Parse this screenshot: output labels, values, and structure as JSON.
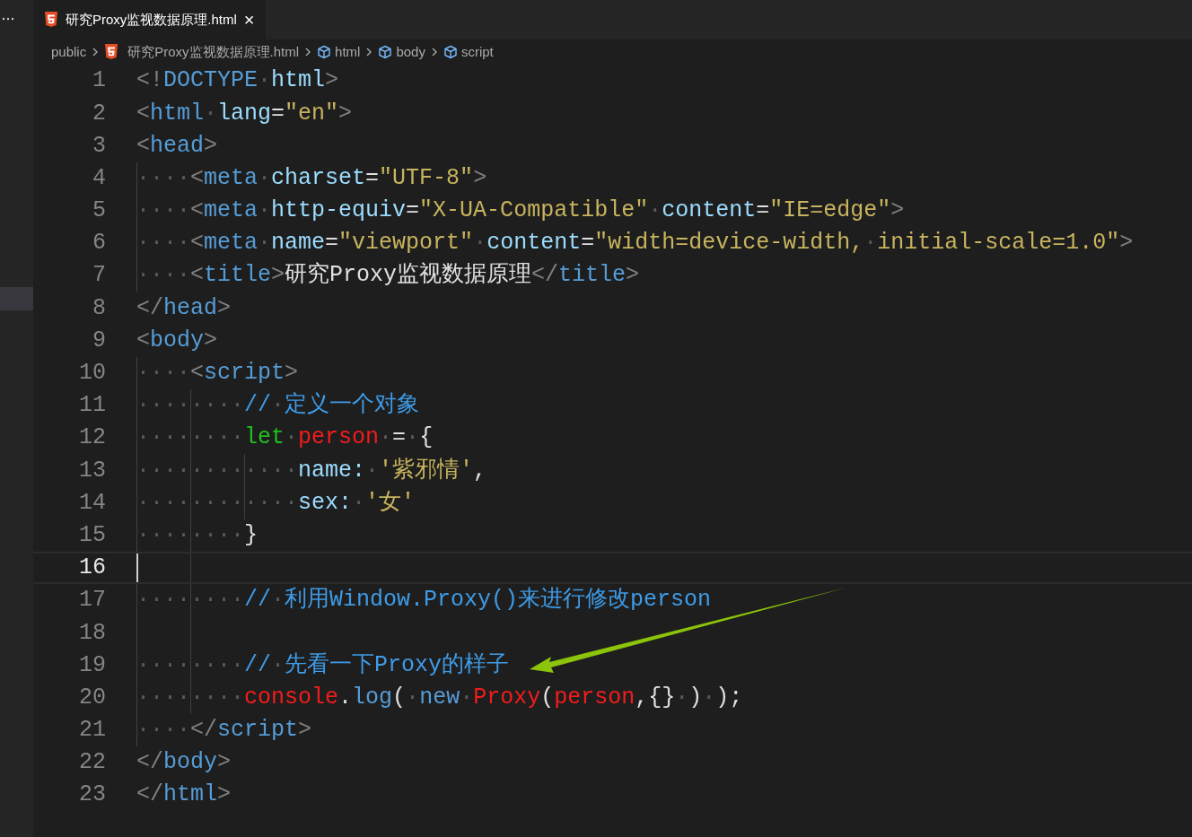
{
  "tab": {
    "title": "研究Proxy监视数据原理.html",
    "close": "×",
    "selected": true
  },
  "breadcrumbs": [
    {
      "kind": "folder",
      "label": "public"
    },
    {
      "kind": "file",
      "label": "研究Proxy监视数据原理.html"
    },
    {
      "kind": "symbol",
      "label": "html"
    },
    {
      "kind": "symbol",
      "label": "body"
    },
    {
      "kind": "symbol",
      "label": "script"
    }
  ],
  "lines": [
    {
      "number": "1",
      "current": false,
      "tokens": [
        {
          "kind": "p",
          "text": "<!"
        },
        {
          "kind": "t",
          "text": "DOCTYPE"
        },
        {
          "kind": "w",
          "text": "·"
        },
        {
          "kind": "a",
          "text": "html"
        },
        {
          "kind": "p",
          "text": ">"
        }
      ]
    },
    {
      "number": "2",
      "current": false,
      "tokens": [
        {
          "kind": "p",
          "text": "<"
        },
        {
          "kind": "t",
          "text": "html"
        },
        {
          "kind": "w",
          "text": "·"
        },
        {
          "kind": "a",
          "text": "lang"
        },
        {
          "kind": "x",
          "text": "="
        },
        {
          "kind": "s",
          "text": "\"en\""
        },
        {
          "kind": "p",
          "text": ">"
        }
      ]
    },
    {
      "number": "3",
      "current": false,
      "tokens": [
        {
          "kind": "p",
          "text": "<"
        },
        {
          "kind": "t",
          "text": "head"
        },
        {
          "kind": "p",
          "text": ">"
        }
      ]
    },
    {
      "number": "4",
      "current": false,
      "tokens": [
        {
          "kind": "w",
          "text": "····"
        },
        {
          "kind": "p",
          "text": "<"
        },
        {
          "kind": "t",
          "text": "meta"
        },
        {
          "kind": "w",
          "text": "·"
        },
        {
          "kind": "a",
          "text": "charset"
        },
        {
          "kind": "x",
          "text": "="
        },
        {
          "kind": "s",
          "text": "\"UTF-8\""
        },
        {
          "kind": "p",
          "text": ">"
        }
      ]
    },
    {
      "number": "5",
      "current": false,
      "tokens": [
        {
          "kind": "w",
          "text": "····"
        },
        {
          "kind": "p",
          "text": "<"
        },
        {
          "kind": "t",
          "text": "meta"
        },
        {
          "kind": "w",
          "text": "·"
        },
        {
          "kind": "a",
          "text": "http-equiv"
        },
        {
          "kind": "x",
          "text": "="
        },
        {
          "kind": "s",
          "text": "\"X-UA-Compatible\""
        },
        {
          "kind": "w",
          "text": "·"
        },
        {
          "kind": "a",
          "text": "content"
        },
        {
          "kind": "x",
          "text": "="
        },
        {
          "kind": "s",
          "text": "\"IE=edge\""
        },
        {
          "kind": "p",
          "text": ">"
        }
      ]
    },
    {
      "number": "6",
      "current": false,
      "tokens": [
        {
          "kind": "w",
          "text": "····"
        },
        {
          "kind": "p",
          "text": "<"
        },
        {
          "kind": "t",
          "text": "meta"
        },
        {
          "kind": "w",
          "text": "·"
        },
        {
          "kind": "a",
          "text": "name"
        },
        {
          "kind": "x",
          "text": "="
        },
        {
          "kind": "s",
          "text": "\"viewport\""
        },
        {
          "kind": "w",
          "text": "·"
        },
        {
          "kind": "a",
          "text": "content"
        },
        {
          "kind": "x",
          "text": "="
        },
        {
          "kind": "s",
          "text": "\"width=device-width,"
        },
        {
          "kind": "w",
          "text": "·"
        },
        {
          "kind": "s",
          "text": "initial-scale=1.0\""
        },
        {
          "kind": "p",
          "text": ">"
        }
      ]
    },
    {
      "number": "7",
      "current": false,
      "tokens": [
        {
          "kind": "w",
          "text": "····"
        },
        {
          "kind": "p",
          "text": "<"
        },
        {
          "kind": "t",
          "text": "title"
        },
        {
          "kind": "p",
          "text": ">"
        },
        {
          "kind": "x",
          "text": "研究Proxy监视数据原理"
        },
        {
          "kind": "p",
          "text": "</"
        },
        {
          "kind": "t",
          "text": "title"
        },
        {
          "kind": "p",
          "text": ">"
        }
      ]
    },
    {
      "number": "8",
      "current": false,
      "tokens": [
        {
          "kind": "p",
          "text": "</"
        },
        {
          "kind": "t",
          "text": "head"
        },
        {
          "kind": "p",
          "text": ">"
        }
      ]
    },
    {
      "number": "9",
      "current": false,
      "tokens": [
        {
          "kind": "p",
          "text": "<"
        },
        {
          "kind": "t",
          "text": "body"
        },
        {
          "kind": "p",
          "text": ">"
        }
      ]
    },
    {
      "number": "10",
      "current": false,
      "tokens": [
        {
          "kind": "w",
          "text": "····"
        },
        {
          "kind": "p",
          "text": "<"
        },
        {
          "kind": "t",
          "text": "script"
        },
        {
          "kind": "p",
          "text": ">"
        }
      ]
    },
    {
      "number": "11",
      "current": false,
      "tokens": [
        {
          "kind": "w",
          "text": "········"
        },
        {
          "kind": "c",
          "text": "//"
        },
        {
          "kind": "w",
          "text": "·"
        },
        {
          "kind": "c",
          "text": "定义一个对象"
        }
      ]
    },
    {
      "number": "12",
      "current": false,
      "tokens": [
        {
          "kind": "w",
          "text": "········"
        },
        {
          "kind": "k",
          "text": "let"
        },
        {
          "kind": "w",
          "text": "·"
        },
        {
          "kind": "v",
          "text": "person"
        },
        {
          "kind": "w",
          "text": "·"
        },
        {
          "kind": "x",
          "text": "="
        },
        {
          "kind": "w",
          "text": "·"
        },
        {
          "kind": "x",
          "text": "{"
        }
      ]
    },
    {
      "number": "13",
      "current": false,
      "tokens": [
        {
          "kind": "w",
          "text": "············"
        },
        {
          "kind": "a",
          "text": "name:"
        },
        {
          "kind": "w",
          "text": "·"
        },
        {
          "kind": "s",
          "text": "'紫邪情'"
        },
        {
          "kind": "x",
          "text": ","
        }
      ]
    },
    {
      "number": "14",
      "current": false,
      "tokens": [
        {
          "kind": "w",
          "text": "············"
        },
        {
          "kind": "a",
          "text": "sex:"
        },
        {
          "kind": "w",
          "text": "·"
        },
        {
          "kind": "s",
          "text": "'女'"
        }
      ]
    },
    {
      "number": "15",
      "current": false,
      "tokens": [
        {
          "kind": "w",
          "text": "········"
        },
        {
          "kind": "x",
          "text": "}"
        }
      ]
    },
    {
      "number": "16",
      "current": true
    },
    {
      "number": "17",
      "current": false,
      "tokens": [
        {
          "kind": "w",
          "text": "········"
        },
        {
          "kind": "c",
          "text": "//"
        },
        {
          "kind": "w",
          "text": "·"
        },
        {
          "kind": "c",
          "text": "利用Window.Proxy()来进行修改person"
        }
      ]
    },
    {
      "number": "18",
      "current": false
    },
    {
      "number": "19",
      "current": false,
      "tokens": [
        {
          "kind": "w",
          "text": "········"
        },
        {
          "kind": "c",
          "text": "//"
        },
        {
          "kind": "w",
          "text": "·"
        },
        {
          "kind": "c",
          "text": "先看一下Proxy的样子"
        }
      ]
    },
    {
      "number": "20",
      "current": false,
      "tokens": [
        {
          "kind": "w",
          "text": "········"
        },
        {
          "kind": "v",
          "text": "console"
        },
        {
          "kind": "x",
          "text": "."
        },
        {
          "kind": "f",
          "text": "log"
        },
        {
          "kind": "x",
          "text": "("
        },
        {
          "kind": "w",
          "text": "·"
        },
        {
          "kind": "f",
          "text": "new"
        },
        {
          "kind": "w",
          "text": "·"
        },
        {
          "kind": "v",
          "text": "Proxy"
        },
        {
          "kind": "x",
          "text": "("
        },
        {
          "kind": "v",
          "text": "person"
        },
        {
          "kind": "x",
          "text": ",{}"
        },
        {
          "kind": "w",
          "text": "·"
        },
        {
          "kind": "x",
          "text": ")"
        },
        {
          "kind": "w",
          "text": "·"
        },
        {
          "kind": "x",
          "text": ");"
        }
      ]
    },
    {
      "number": "21",
      "current": false,
      "tokens": [
        {
          "kind": "w",
          "text": "····"
        },
        {
          "kind": "p",
          "text": "</"
        },
        {
          "kind": "t",
          "text": "script"
        },
        {
          "kind": "p",
          "text": ">"
        }
      ]
    },
    {
      "number": "22",
      "current": false,
      "tokens": [
        {
          "kind": "p",
          "text": "</"
        },
        {
          "kind": "t",
          "text": "body"
        },
        {
          "kind": "p",
          "text": ">"
        }
      ]
    },
    {
      "number": "23",
      "current": false,
      "tokens": [
        {
          "kind": "p",
          "text": "</"
        },
        {
          "kind": "t",
          "text": "html"
        },
        {
          "kind": "p",
          "text": ">"
        }
      ]
    }
  ]
}
